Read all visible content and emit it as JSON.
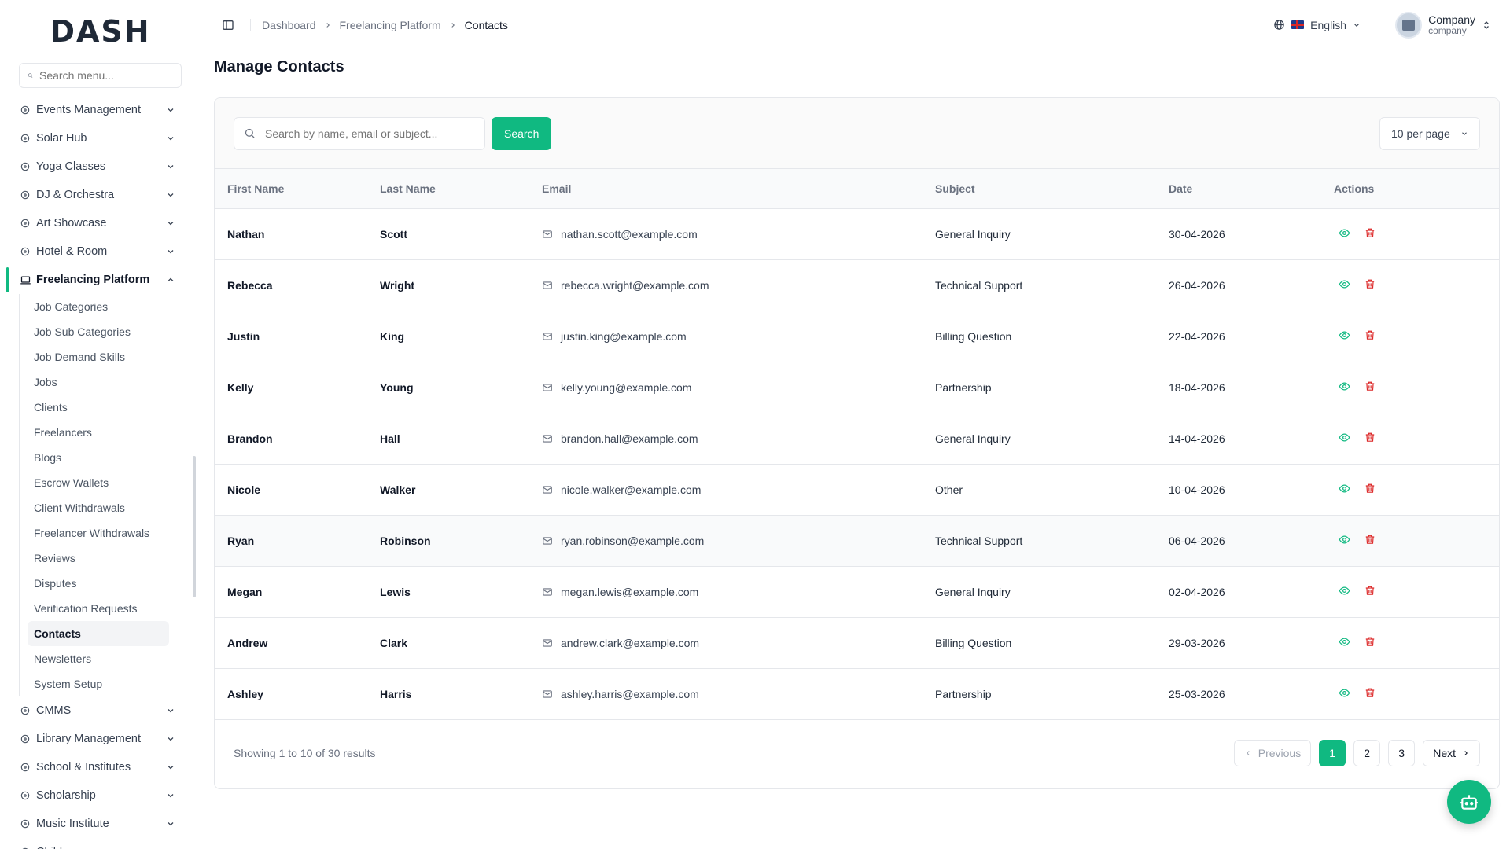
{
  "logo": "DASH",
  "sidebar": {
    "search_placeholder": "Search menu...",
    "top_items": [
      {
        "label": "Events Management",
        "icon": "party-icon"
      },
      {
        "label": "Solar Hub",
        "icon": "zap-icon"
      },
      {
        "label": "Yoga Classes",
        "icon": "sun-icon"
      },
      {
        "label": "DJ & Orchestra",
        "icon": "disc-icon"
      },
      {
        "label": "Art Showcase",
        "icon": "palette-icon"
      },
      {
        "label": "Hotel & Room",
        "icon": "hotel-icon"
      }
    ],
    "active_group": {
      "label": "Freelancing Platform",
      "icon": "laptop-icon"
    },
    "sub_items": [
      "Job Categories",
      "Job Sub Categories",
      "Job Demand Skills",
      "Jobs",
      "Clients",
      "Freelancers",
      "Blogs",
      "Escrow Wallets",
      "Client Withdrawals",
      "Freelancer Withdrawals",
      "Reviews",
      "Disputes",
      "Verification Requests",
      "Contacts",
      "Newsletters",
      "System Setup"
    ],
    "active_sub": "Contacts",
    "bottom_items": [
      {
        "label": "CMMS",
        "icon": "gear-icon"
      },
      {
        "label": "Library Management",
        "icon": "library-icon"
      },
      {
        "label": "School & Institutes",
        "icon": "school-icon"
      },
      {
        "label": "Scholarship",
        "icon": "scholarship-icon"
      },
      {
        "label": "Music Institute",
        "icon": "music-icon"
      },
      {
        "label": "Childcare",
        "icon": "baby-icon"
      }
    ]
  },
  "header": {
    "breadcrumb": [
      "Dashboard",
      "Freelancing Platform",
      "Contacts"
    ],
    "language": "English",
    "user_name": "Company",
    "user_role": "company"
  },
  "page": {
    "title": "Manage Contacts",
    "search_placeholder": "Search by name, email or subject...",
    "search_button": "Search",
    "per_page": "10 per page"
  },
  "table": {
    "columns": [
      "First Name",
      "Last Name",
      "Email",
      "Subject",
      "Date",
      "Actions"
    ],
    "rows": [
      {
        "first": "Nathan",
        "last": "Scott",
        "email": "nathan.scott@example.com",
        "subject": "General Inquiry",
        "date": "30-04-2026"
      },
      {
        "first": "Rebecca",
        "last": "Wright",
        "email": "rebecca.wright@example.com",
        "subject": "Technical Support",
        "date": "26-04-2026"
      },
      {
        "first": "Justin",
        "last": "King",
        "email": "justin.king@example.com",
        "subject": "Billing Question",
        "date": "22-04-2026"
      },
      {
        "first": "Kelly",
        "last": "Young",
        "email": "kelly.young@example.com",
        "subject": "Partnership",
        "date": "18-04-2026"
      },
      {
        "first": "Brandon",
        "last": "Hall",
        "email": "brandon.hall@example.com",
        "subject": "General Inquiry",
        "date": "14-04-2026"
      },
      {
        "first": "Nicole",
        "last": "Walker",
        "email": "nicole.walker@example.com",
        "subject": "Other",
        "date": "10-04-2026"
      },
      {
        "first": "Ryan",
        "last": "Robinson",
        "email": "ryan.robinson@example.com",
        "subject": "Technical Support",
        "date": "06-04-2026"
      },
      {
        "first": "Megan",
        "last": "Lewis",
        "email": "megan.lewis@example.com",
        "subject": "General Inquiry",
        "date": "02-04-2026"
      },
      {
        "first": "Andrew",
        "last": "Clark",
        "email": "andrew.clark@example.com",
        "subject": "Billing Question",
        "date": "29-03-2026"
      },
      {
        "first": "Ashley",
        "last": "Harris",
        "email": "ashley.harris@example.com",
        "subject": "Partnership",
        "date": "25-03-2026"
      }
    ]
  },
  "pagination": {
    "summary": "Showing 1 to 10 of 30 results",
    "previous": "Previous",
    "next": "Next",
    "pages": [
      "1",
      "2",
      "3"
    ],
    "current": "1"
  },
  "colors": {
    "accent": "#10b981",
    "danger": "#dc2626"
  }
}
